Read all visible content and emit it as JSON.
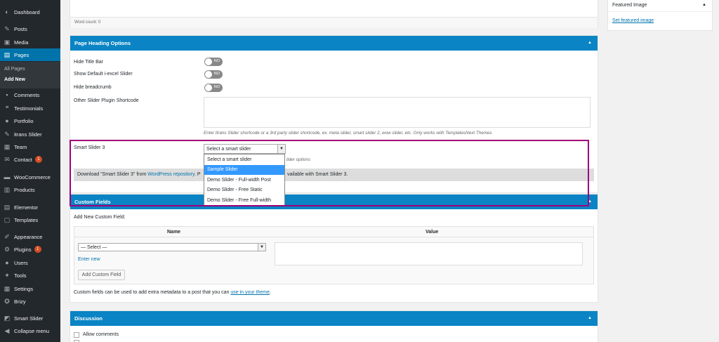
{
  "sidebar": {
    "items": [
      {
        "label": "Dashboard",
        "icon": "dashboard-icon",
        "glyph": "◐"
      },
      {
        "label": "Posts",
        "icon": "pin-icon",
        "glyph": "✎"
      },
      {
        "label": "Media",
        "icon": "media-icon",
        "glyph": "▣"
      },
      {
        "label": "Pages",
        "icon": "pages-icon",
        "glyph": "▤"
      },
      {
        "label": "Comments",
        "icon": "comments-icon",
        "glyph": "▪"
      },
      {
        "label": "Testimonials",
        "icon": "quote-icon",
        "glyph": "❝"
      },
      {
        "label": "Portfolio",
        "icon": "portfolio-icon",
        "glyph": "●"
      },
      {
        "label": "itrans Slider",
        "icon": "pin-icon",
        "glyph": "✎"
      },
      {
        "label": "Team",
        "icon": "team-icon",
        "glyph": "▦"
      },
      {
        "label": "Contact",
        "icon": "mail-icon",
        "glyph": "✉",
        "badge": "1"
      },
      {
        "label": "WooCommerce",
        "icon": "woocommerce-icon",
        "glyph": "▬"
      },
      {
        "label": "Products",
        "icon": "products-icon",
        "glyph": "▥"
      },
      {
        "label": "Elementor",
        "icon": "elementor-icon",
        "glyph": "▤"
      },
      {
        "label": "Templates",
        "icon": "templates-icon",
        "glyph": "▢"
      },
      {
        "label": "Appearance",
        "icon": "brush-icon",
        "glyph": "✐"
      },
      {
        "label": "Plugins",
        "icon": "plugin-icon",
        "glyph": "⚙",
        "badge": "1"
      },
      {
        "label": "Users",
        "icon": "users-icon",
        "glyph": "●"
      },
      {
        "label": "Tools",
        "icon": "wrench-icon",
        "glyph": "✦"
      },
      {
        "label": "Settings",
        "icon": "settings-icon",
        "glyph": "▦"
      },
      {
        "label": "Brizy",
        "icon": "brizy-icon",
        "glyph": "✪"
      },
      {
        "label": "Smart Slider",
        "icon": "smart-slider-icon",
        "glyph": "◩"
      },
      {
        "label": "Collapse menu",
        "icon": "collapse-icon",
        "glyph": "◀"
      }
    ],
    "submenu": {
      "all_pages": "All Pages",
      "add_new": "Add New"
    }
  },
  "editor": {
    "word_count": "Word count: 0"
  },
  "featured": {
    "title": "Featured Image",
    "link": "Set featured image"
  },
  "page_heading": {
    "title": "Page Heading Options",
    "hide_title_bar": "Hide Title Bar",
    "show_default_slider": "Show Default i-excel Slider",
    "hide_breadcrumb": "Hide breadcrumb",
    "toggle_text": "NO",
    "other_shortcode": "Other Slider Plugin Shortcode",
    "shortcode_help": "Enter Itrans Slider shortcode or a 3rd party slider shortcode, ex. meta slider, smart slider 2, wow slider, etc. Only works with TemplatesNext Themes",
    "smart_slider_label": "Smart Slider 3",
    "smart_slider_value": "Select a smart slider",
    "slider_options_hint": "lider options",
    "download_prefix": "Download \"Smart Slider 3\" from ",
    "download_link": "WordPress repository",
    "download_suffix": ". P",
    "download_tail": "vailable with Smart Slider 3.",
    "dropdown_options": [
      "Select a smart slider",
      "Sample Slider",
      "Demo Slider - Full-width Post",
      "Demo Slider - Free Static",
      "Demo Slider - Free Full-width"
    ],
    "selected_index": 1
  },
  "custom_fields": {
    "title": "Custom Fields",
    "add_new": "Add New Custom Field:",
    "col_name": "Name",
    "col_value": "Value",
    "select_value": "— Select —",
    "enter_new": "Enter new",
    "add_button": "Add Custom Field",
    "help_prefix": "Custom fields can be used to add extra metadata to a post that you can ",
    "help_link": "use in your theme",
    "help_suffix": "."
  },
  "discussion": {
    "title": "Discussion",
    "allow_comments": "Allow comments"
  },
  "colors": {
    "accent": "#0a84c4",
    "sidebar": "#23282d",
    "highlight": "#a0007a",
    "active": "#0073aa"
  }
}
